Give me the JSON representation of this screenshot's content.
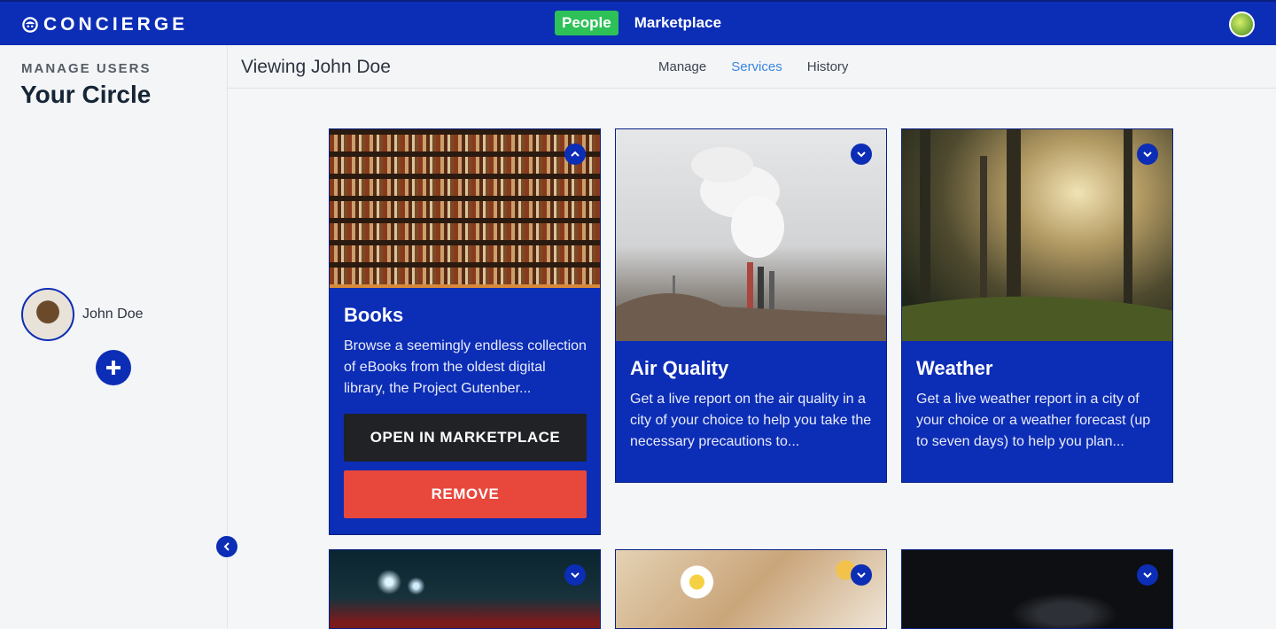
{
  "app": {
    "logo_text": "CONCIERGE",
    "nav": {
      "people": "People",
      "marketplace": "Marketplace"
    }
  },
  "sidebar": {
    "section_label": "MANAGE USERS",
    "title": "Your Circle",
    "users": [
      {
        "name": "John Doe"
      }
    ],
    "add_icon": "plus-icon",
    "collapse_icon": "chevron-left-icon"
  },
  "header": {
    "viewing": "Viewing John Doe",
    "tabs": [
      {
        "label": "Manage",
        "active": false
      },
      {
        "label": "Services",
        "active": true
      },
      {
        "label": "History",
        "active": false
      }
    ]
  },
  "services": [
    {
      "title": "Books",
      "description": "Browse a seemingly endless collection of eBooks from the oldest digital library, the Project Gutenber...",
      "expanded": true,
      "open_label": "OPEN IN MARKETPLACE",
      "remove_label": "REMOVE"
    },
    {
      "title": "Air Quality",
      "description": "Get a live report on the air quality in a city of your choice to help you take the necessary precautions to...",
      "expanded": false
    },
    {
      "title": "Weather",
      "description": "Get a live weather report in a city of your choice or a weather forecast (up to seven days) to help you plan...",
      "expanded": false
    },
    {
      "title": "",
      "description": "",
      "expanded": false
    },
    {
      "title": "",
      "description": "",
      "expanded": false
    },
    {
      "title": "",
      "description": "",
      "expanded": false
    }
  ],
  "colors": {
    "brand_blue": "#0c2db5",
    "people_green": "#2ec158",
    "remove_red": "#e8473c",
    "active_tab": "#3a86e0"
  }
}
